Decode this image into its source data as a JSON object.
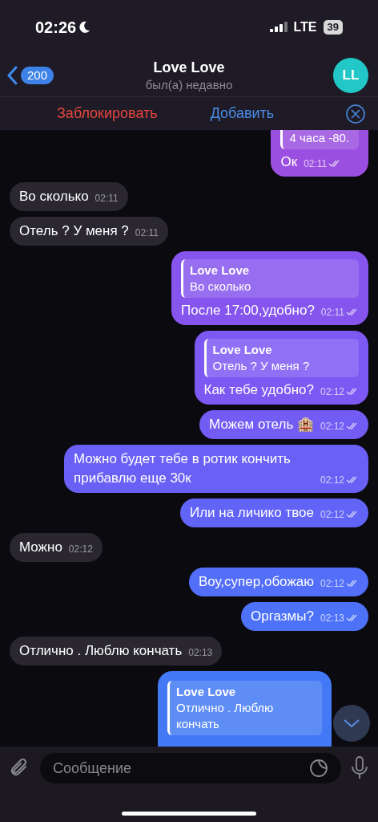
{
  "status_bar": {
    "time": "02:26",
    "network": "LTE",
    "battery": "39"
  },
  "header": {
    "back_count": "200",
    "title": "Love Love",
    "subtitle": "был(а) недавно",
    "avatar": "LL"
  },
  "action_bar": {
    "block": "Заблокировать",
    "add": "Добавить"
  },
  "messages": [
    {
      "kind": "out",
      "quote": {
        "text": "4 часа -80."
      },
      "text": "Ок",
      "time": "02:11",
      "read": true
    },
    {
      "kind": "in",
      "text": "Во сколько",
      "time": "02:11"
    },
    {
      "kind": "in",
      "text": "Отель ? У меня ?",
      "time": "02:11"
    },
    {
      "kind": "out",
      "quote": {
        "author": "Love Love",
        "text": "Во сколько"
      },
      "text": "После 17:00,удобно?",
      "time": "02:11",
      "read": true
    },
    {
      "kind": "out",
      "quote": {
        "author": "Love Love",
        "text": "Отель ? У меня ?"
      },
      "text": "Как тебе удобно?",
      "time": "02:12",
      "read": true
    },
    {
      "kind": "out",
      "text": "Можем отель 🏨",
      "time": "02:12",
      "read": true
    },
    {
      "kind": "out",
      "text": "Можно будет тебе в ротик кончить прибавлю еще 30к",
      "time": "02:12",
      "read": true
    },
    {
      "kind": "out",
      "text": "Или на личико твое",
      "time": "02:12",
      "read": true
    },
    {
      "kind": "in",
      "text": "Можно",
      "time": "02:12"
    },
    {
      "kind": "out",
      "text": "Воу,супер,обожаю",
      "time": "02:12",
      "read": true
    },
    {
      "kind": "out",
      "text": "Оргазмы?",
      "time": "02:13",
      "read": true
    },
    {
      "kind": "in",
      "text": "Отлично . Люблю кончать",
      "time": "02:13"
    },
    {
      "kind": "out",
      "quote": {
        "author": "Love Love",
        "text": "Отлично . Люблю кончать"
      }
    }
  ],
  "input": {
    "placeholder": "Сообщение"
  }
}
